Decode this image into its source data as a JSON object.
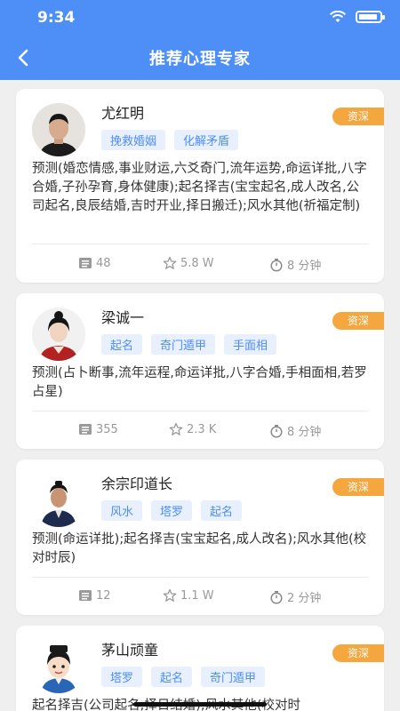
{
  "status": {
    "time": "9:34"
  },
  "header": {
    "title": "推荐心理专家"
  },
  "experts": [
    {
      "name": "尤红明",
      "tags": [
        "挽救婚姻",
        "化解矛盾"
      ],
      "badge": "资深",
      "desc": "预测(婚恋情感,事业财运,六爻奇门,流年运势,命运详批,八字合婚,子孙孕育,身体健康);起名择吉(宝宝起名,成人改名,公司起名,良辰结婚,吉时开业,择日搬迁);风水其他(祈福定制)",
      "consults": "48",
      "rating": "5.8 W",
      "response": "8 分钟"
    },
    {
      "name": "梁诚一",
      "tags": [
        "起名",
        "奇门遁甲",
        "手面相"
      ],
      "badge": "资深",
      "desc": "预测(占卜断事,流年运程,命运详批,八字合婚,手相面相,若罗占星)",
      "consults": "355",
      "rating": "2.3 K",
      "response": "8 分钟"
    },
    {
      "name": "余宗印道长",
      "tags": [
        "风水",
        "塔罗",
        "起名"
      ],
      "badge": "资深",
      "desc": "预测(命运详批);起名择吉(宝宝起名,成人改名);风水其他(校对时辰)",
      "consults": "12",
      "rating": "1.1 W",
      "response": "2 分钟"
    },
    {
      "name": "茅山顽童",
      "tags": [
        "塔罗",
        "起名",
        "奇门遁甲"
      ],
      "badge": "资深",
      "desc": "起名择吉(公司起名,择日结婚);风水其他(校对时",
      "consults": "",
      "rating": "",
      "response": ""
    }
  ],
  "colors": {
    "brand": "#4e8ef7",
    "badge": "#f4a63f",
    "tag_bg": "#e8f0fd"
  }
}
